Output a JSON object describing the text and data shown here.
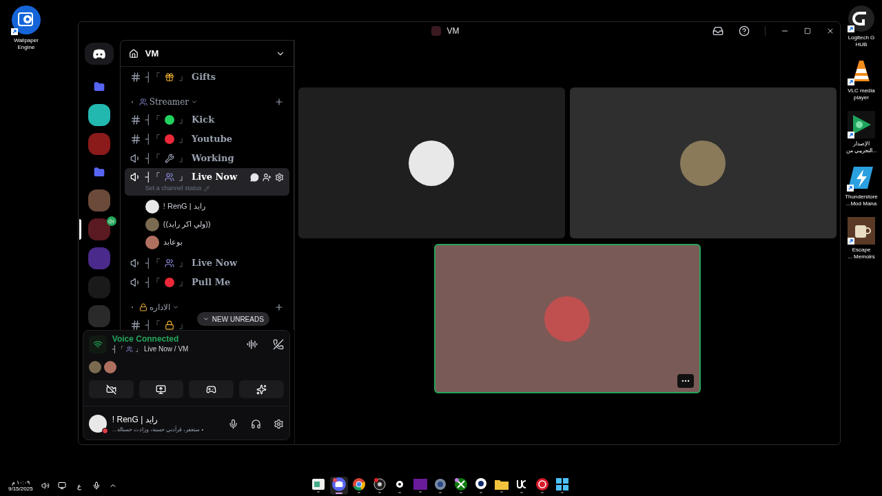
{
  "desktop_left": [
    {
      "lines": [
        "Wallpaper",
        "Engine"
      ],
      "kind": "wallpaper"
    }
  ],
  "desktop_right": [
    {
      "lines": [
        "Logitech G",
        "HUB"
      ],
      "kind": "logitech"
    },
    {
      "lines": [
        "VLC media",
        "player"
      ],
      "kind": "vlc"
    },
    {
      "lines": [
        "الإصدار",
        "التجريبي من..."
      ],
      "kind": "play"
    },
    {
      "lines": [
        "Thunderstore",
        "...Mod Mana"
      ],
      "kind": "thunder"
    },
    {
      "lines": [
        "Escape",
        "... Memoirs"
      ],
      "kind": "cup"
    }
  ],
  "window": {
    "title": "VM"
  },
  "servers": [
    {
      "kind": "logo"
    },
    {
      "kind": "folder",
      "color": "#5865f2",
      "in_voice": false,
      "selected": false
    },
    {
      "kind": "server",
      "color": "#22b8b0",
      "in_voice": false,
      "selected": false
    },
    {
      "kind": "server",
      "color": "#8b1a1a",
      "in_voice": false,
      "selected": false
    },
    {
      "kind": "folder",
      "color": "#5865f2",
      "in_voice": false,
      "selected": false
    },
    {
      "kind": "server",
      "color": "#6b4a3a",
      "in_voice": false,
      "selected": false
    },
    {
      "kind": "server",
      "color": "#5a1a22",
      "in_voice": true,
      "selected": true
    },
    {
      "kind": "server",
      "color": "#4a2a8a",
      "in_voice": false,
      "selected": false
    },
    {
      "kind": "server",
      "color": "#1a1a1a",
      "in_voice": false,
      "selected": false
    },
    {
      "kind": "server",
      "color": "#2a2a2a",
      "in_voice": false,
      "selected": false
    }
  ],
  "guild": {
    "name": "VM"
  },
  "channels": [
    {
      "kind": "text",
      "prefix": "┤「",
      "emblem": {
        "kind": "gift"
      },
      "suffix": "」",
      "name": "Gifts",
      "selected": false
    },
    {
      "kind": "category",
      "emblem": {
        "kind": "people"
      },
      "name": "Streamer"
    },
    {
      "kind": "text",
      "prefix": "┤「",
      "emblem": {
        "kind": "dot",
        "color": "#23d160"
      },
      "suffix": "」",
      "name": "Kick",
      "selected": false
    },
    {
      "kind": "text",
      "prefix": "┤「",
      "emblem": {
        "kind": "dot",
        "color": "#ed2939"
      },
      "suffix": "」",
      "name": "Youtube",
      "selected": false
    },
    {
      "kind": "voice",
      "prefix": "┤「",
      "emblem": {
        "kind": "tools"
      },
      "suffix": "」",
      "name": "Working",
      "selected": false
    },
    {
      "kind": "voice",
      "prefix": "┤「",
      "emblem": {
        "kind": "people"
      },
      "suffix": "」",
      "name": "Live Now",
      "selected": true,
      "status": "Set a channel status",
      "members": [
        {
          "name": "! RenG | رايد",
          "color": "#e8e8e8"
        },
        {
          "name": "((ولي اكر رايد))",
          "color": "#7a6a50"
        },
        {
          "name": "بوعابد",
          "color": "#b07060"
        }
      ]
    },
    {
      "kind": "voice",
      "prefix": "┤「",
      "emblem": {
        "kind": "people"
      },
      "suffix": "」",
      "name": "Live Now",
      "selected": false
    },
    {
      "kind": "voice",
      "prefix": "┤「",
      "emblem": {
        "kind": "dot",
        "color": "#ed2939"
      },
      "suffix": "」",
      "name": "Pull Me",
      "selected": false
    },
    {
      "kind": "category",
      "emblem": {
        "kind": "lock"
      },
      "name": "الاداره"
    },
    {
      "kind": "text",
      "prefix": "┤「",
      "emblem": {
        "kind": "lock"
      },
      "suffix": "」",
      "selected": false
    }
  ],
  "new_unreads": "NEW UNREADS",
  "voice": {
    "status": "Voice Connected",
    "prefix": "┤「",
    "emblem": {
      "kind": "people"
    },
    "suffix": "」",
    "channel": "Live Now / VM",
    "participants": [
      {
        "color": "#7a6a50"
      },
      {
        "color": "#b07060"
      }
    ]
  },
  "user": {
    "name": "! RenG | رايد",
    "status": "...ستغفر، قرآدني حسنة، وزادت حسنالة •"
  },
  "tiles": [
    {
      "color": "#1f1f1f",
      "avatar": {
        "color": "#e8e8e8"
      },
      "speaking": false
    },
    {
      "color": "#2f2f2f",
      "avatar": {
        "color": "#8a7a5a"
      },
      "speaking": false
    },
    {
      "color": "#7a5a56",
      "avatar": {
        "color": "#c05050"
      },
      "speaking": true
    }
  ],
  "taskbar": {
    "time": "١٠:٠٩ م",
    "date": "9/15/2025",
    "language": "ع",
    "apps": [
      {
        "kind": "notes",
        "selected": false
      },
      {
        "kind": "discord",
        "selected": true
      },
      {
        "kind": "chrome",
        "selected": false
      },
      {
        "kind": "obs",
        "selected": false
      },
      {
        "kind": "steel",
        "selected": false
      },
      {
        "kind": "nzxt",
        "selected": false
      },
      {
        "kind": "gear",
        "selected": false
      },
      {
        "kind": "xbox",
        "selected": false
      },
      {
        "kind": "camera",
        "selected": false
      },
      {
        "kind": "folder",
        "selected": false
      },
      {
        "kind": "uc",
        "selected": false
      },
      {
        "kind": "red",
        "selected": false
      },
      {
        "kind": "windows",
        "selected": false
      }
    ]
  }
}
